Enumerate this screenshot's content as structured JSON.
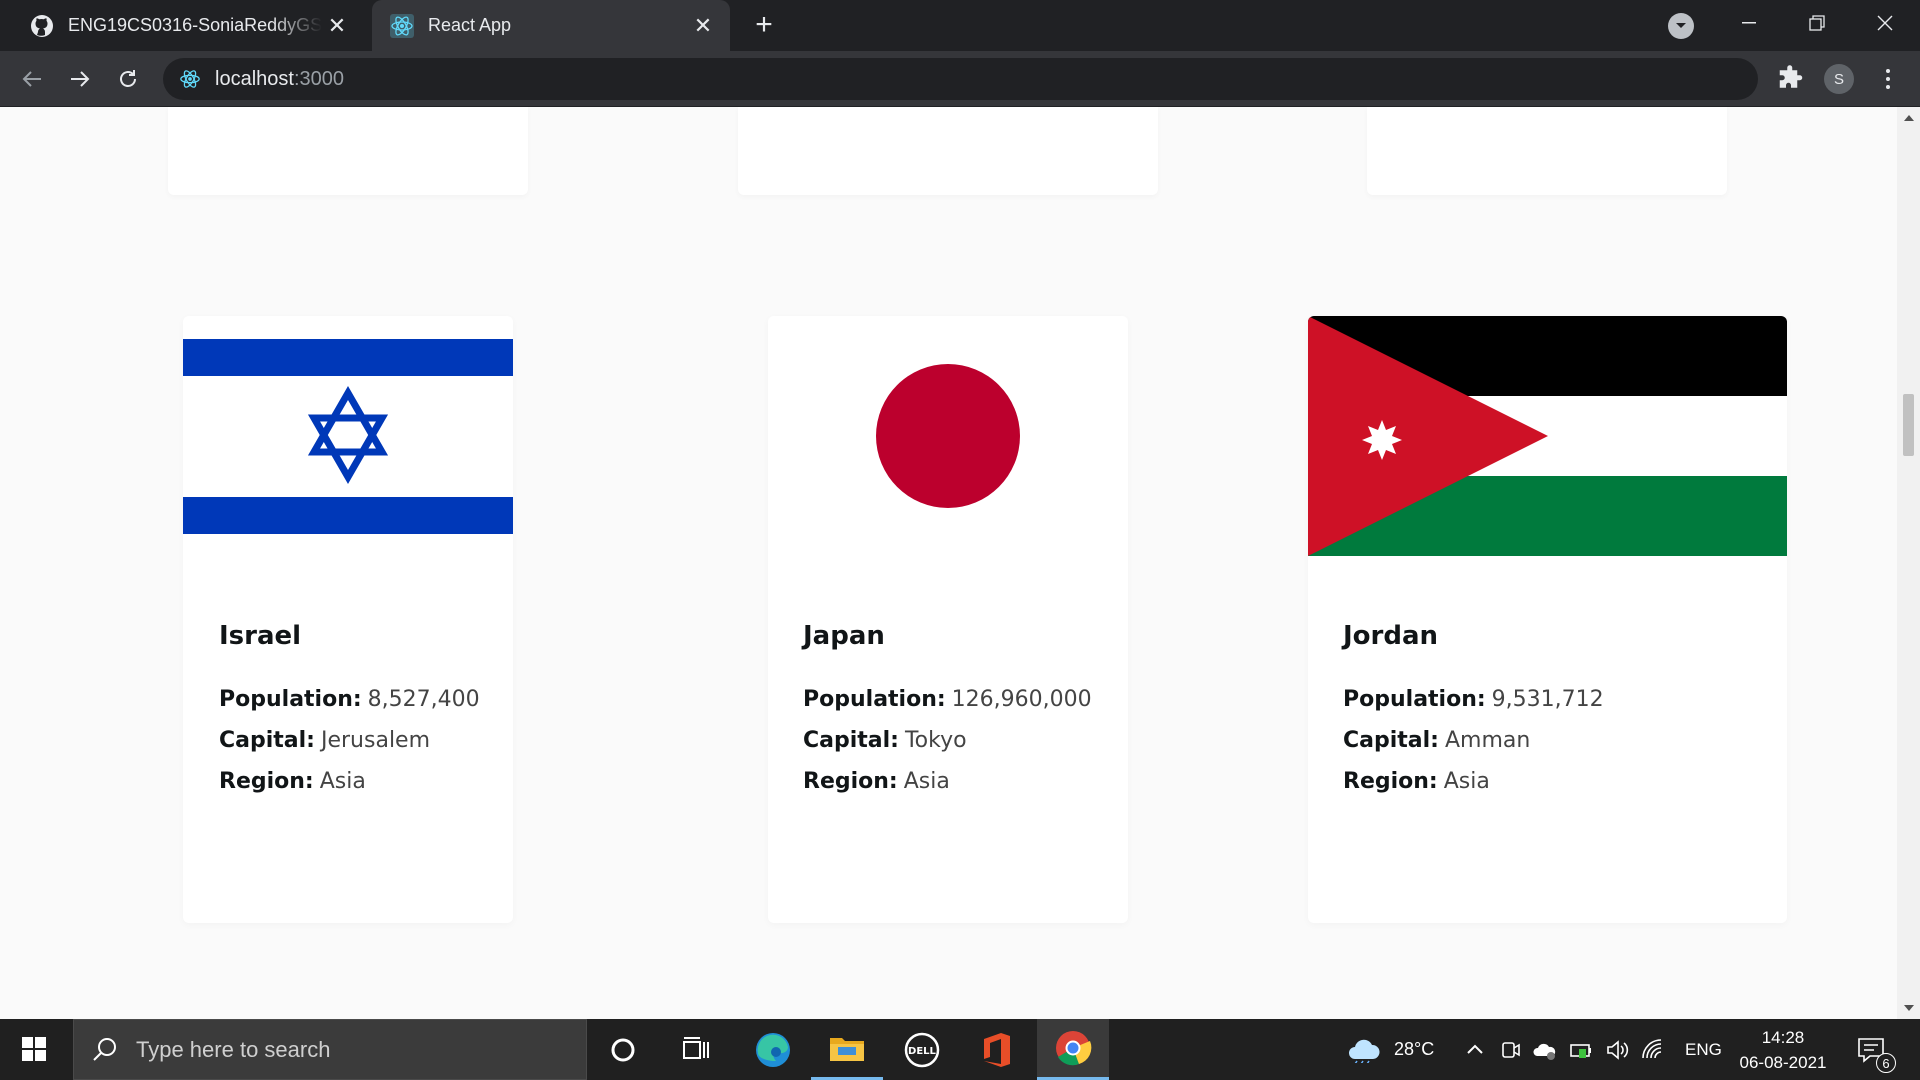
{
  "browser": {
    "tabs": [
      {
        "title": "ENG19CS0316-SoniaReddyGS/fir",
        "favicon": "github-icon",
        "active": false
      },
      {
        "title": "React App",
        "favicon": "react-icon",
        "active": true
      }
    ],
    "address": {
      "host": "localhost",
      "port": ":3000"
    },
    "profile_initial": "S"
  },
  "page": {
    "countries": [
      {
        "name": "Israel",
        "population_label": "Population:",
        "population": "8,527,400",
        "capital_label": "Capital:",
        "capital": "Jerusalem",
        "region_label": "Region:",
        "region": "Asia",
        "flag": "israel-flag"
      },
      {
        "name": "Japan",
        "population_label": "Population:",
        "population": "126,960,000",
        "capital_label": "Capital:",
        "capital": "Tokyo",
        "region_label": "Region:",
        "region": "Asia",
        "flag": "japan-flag"
      },
      {
        "name": "Jordan",
        "population_label": "Population:",
        "population": "9,531,712",
        "capital_label": "Capital:",
        "capital": "Amman",
        "region_label": "Region:",
        "region": "Asia",
        "flag": "jordan-flag"
      }
    ],
    "colors": {
      "background": "#fafafa",
      "card": "#ffffff",
      "israel_blue": "#0038b8",
      "japan_red": "#bc002d",
      "jordan_red": "#ce1126",
      "jordan_green": "#007a3d"
    }
  },
  "taskbar": {
    "search_placeholder": "Type here to search",
    "weather": "28°C",
    "language": "ENG",
    "time": "14:28",
    "date": "06-08-2021",
    "notification_count": "6"
  }
}
